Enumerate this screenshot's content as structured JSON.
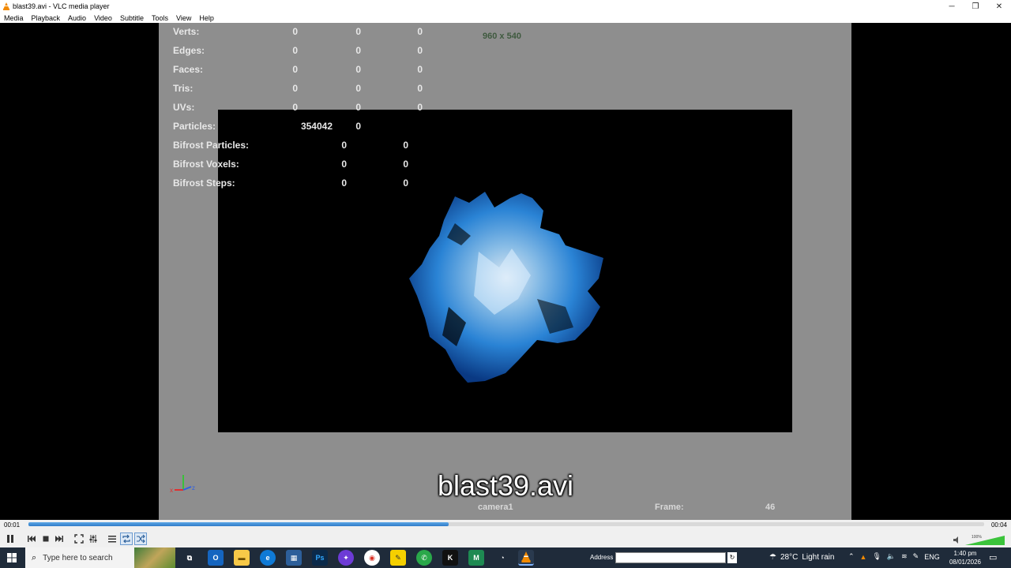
{
  "window": {
    "title": "blast39.avi - VLC media player",
    "minimize_icon": "─",
    "restore_icon": "❐",
    "close_icon": "✕"
  },
  "menu": {
    "items": [
      "Media",
      "Playback",
      "Audio",
      "Video",
      "Subtitle",
      "Tools",
      "View",
      "Help"
    ]
  },
  "video": {
    "hud_rows": [
      {
        "label": "Verts:",
        "a": "0",
        "b": "0",
        "c": "0"
      },
      {
        "label": "Edges:",
        "a": "0",
        "b": "0",
        "c": "0"
      },
      {
        "label": "Faces:",
        "a": "0",
        "b": "0",
        "c": "0"
      },
      {
        "label": "Tris:",
        "a": "0",
        "b": "0",
        "c": "0"
      },
      {
        "label": "UVs:",
        "a": "0",
        "b": "0",
        "c": "0"
      },
      {
        "label": "Particles:",
        "a": "354042",
        "b": "0",
        "c": ""
      },
      {
        "label": "Bifrost Particles:",
        "a": "",
        "b": "0",
        "c": "0"
      },
      {
        "label": "Bifrost Voxels:",
        "a": "",
        "b": "0",
        "c": "0"
      },
      {
        "label": "Bifrost Steps:",
        "a": "",
        "b": "0",
        "c": "0"
      }
    ],
    "resolution": "960 x 540",
    "camera": "camera1",
    "frame_label": "Frame:",
    "frame_value": "46",
    "osd_title": "blast39.avi",
    "axis_x": "x",
    "axis_z": "z"
  },
  "seek": {
    "elapsed": "00:01",
    "total": "00:04",
    "progress": 0.44
  },
  "controls": {
    "volume_percent": "100%",
    "volume_level": 1.0
  },
  "taskbar": {
    "search_placeholder": "Type here to search",
    "address_label": "Address",
    "weather_temp": "28°C",
    "weather_desc": "Light rain",
    "language": "ENG",
    "time": "1:40 pm",
    "date": "08/01/2026",
    "colors": {
      "taskbar_bg": "#1f2b3a",
      "vlc_orange": "#f28a00",
      "progress_blue": "#2f7cc8"
    }
  }
}
